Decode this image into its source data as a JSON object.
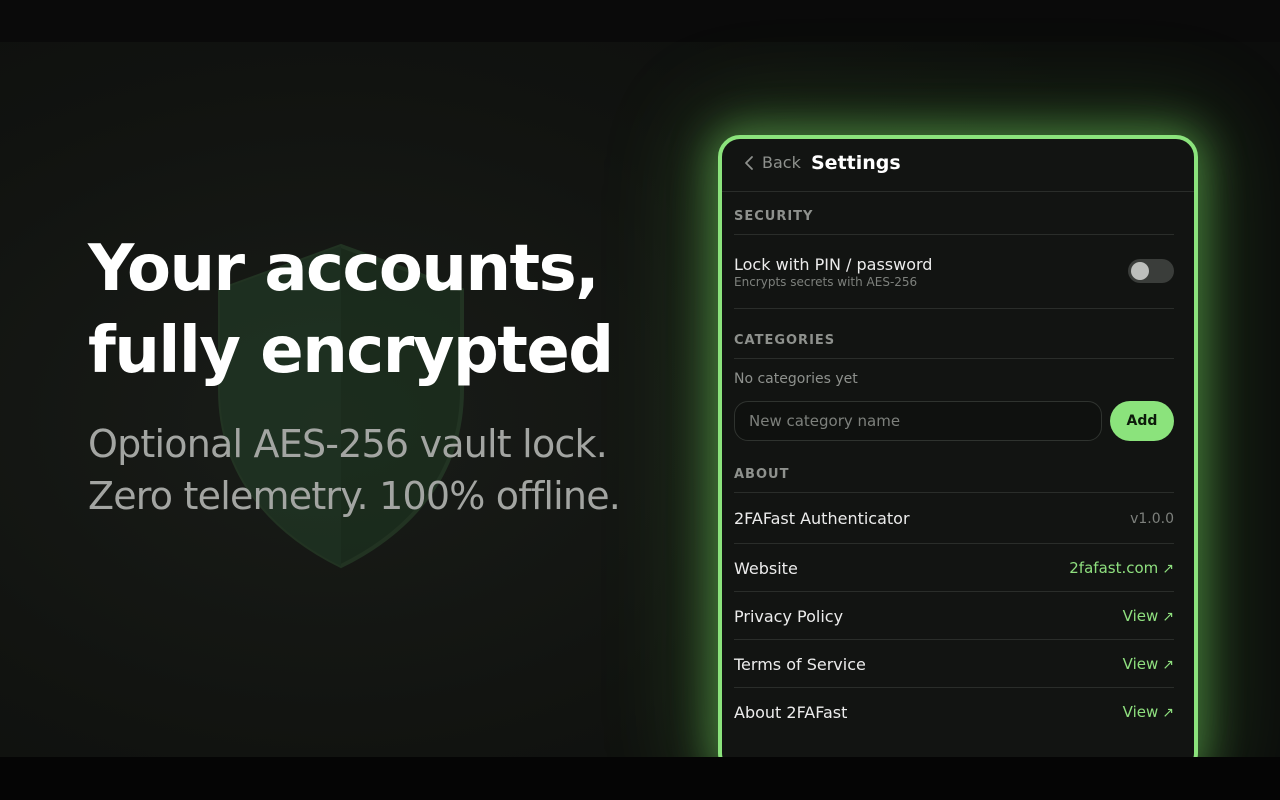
{
  "hero": {
    "headline_line1": "Your accounts,",
    "headline_line2": "fully encrypted",
    "sub_line1": "Optional AES-256 vault lock.",
    "sub_line2": "Zero telemetry. 100% offline."
  },
  "settings": {
    "back_label": "Back",
    "title": "Settings",
    "security": {
      "heading": "SECURITY",
      "lock_label": "Lock with PIN / password",
      "lock_sub": "Encrypts secrets with AES-256",
      "lock_enabled": false
    },
    "categories": {
      "heading": "CATEGORIES",
      "empty_text": "No categories yet",
      "input_placeholder": "New category name",
      "add_label": "Add"
    },
    "about": {
      "heading": "ABOUT",
      "app_name": "2FAFast Authenticator",
      "version": "v1.0.0",
      "website_label": "Website",
      "website_value": "2fafast.com",
      "privacy_label": "Privacy Policy",
      "privacy_value": "View",
      "terms_label": "Terms of Service",
      "terms_value": "View",
      "about_label": "About 2FAFast",
      "about_value": "View",
      "link_arrow": "↗"
    }
  },
  "colors": {
    "accent": "#8be37c",
    "background": "#111310",
    "panel": "#121412"
  },
  "icons": {
    "back": "chevron-left-icon",
    "external": "external-link-arrow-icon",
    "background_art": "shield-icon"
  }
}
